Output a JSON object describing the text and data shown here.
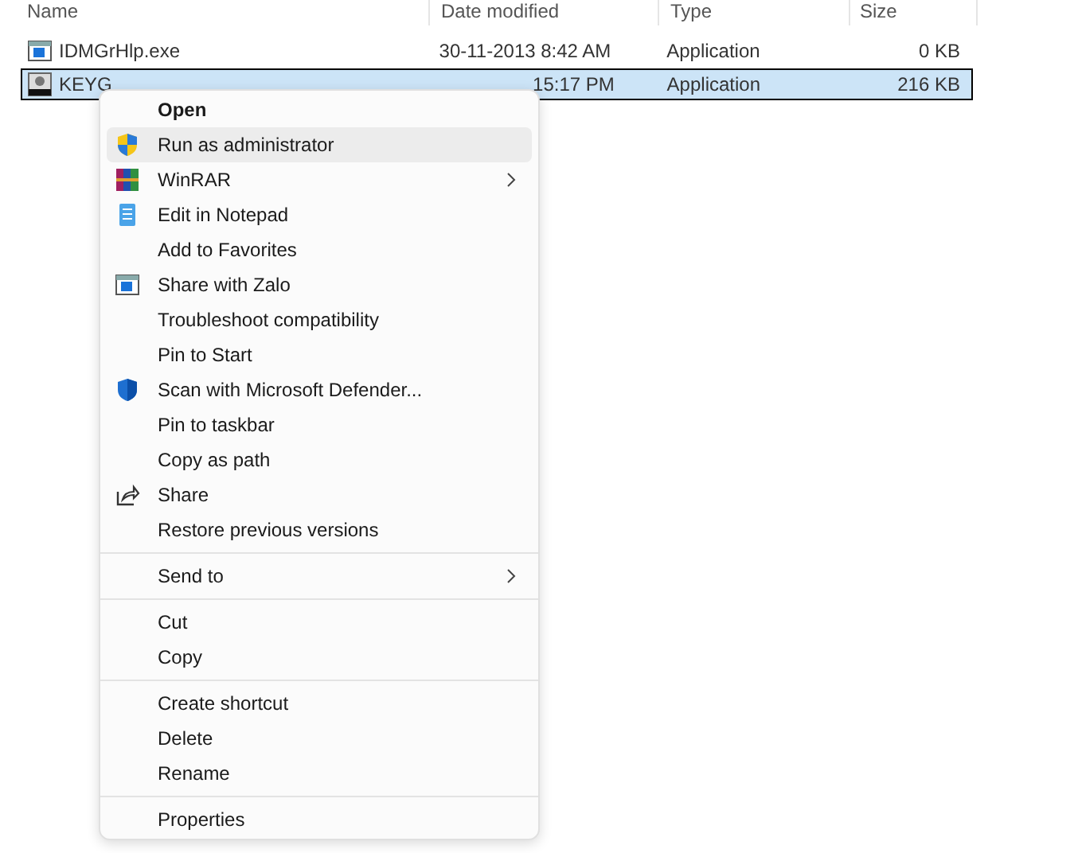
{
  "columns": [
    "Name",
    "Date modified",
    "Type",
    "Size"
  ],
  "files": [
    {
      "kind": "window",
      "name": "IDMGrHlp.exe",
      "date": "30-11-2013 8:42 AM",
      "type": "Application",
      "size": "0 KB",
      "selected": false
    },
    {
      "kind": "keygen",
      "name": "KEYG",
      "date": "15:17 PM",
      "type": "Application",
      "size": "216 KB",
      "selected": true
    }
  ],
  "menu": [
    {
      "kind": "item",
      "label": "Open",
      "default": true,
      "highlighted": false,
      "submenu": false
    },
    {
      "kind": "shield",
      "label": "Run as administrator",
      "default": false,
      "highlighted": true,
      "submenu": false
    },
    {
      "kind": "books",
      "label": "WinRAR",
      "default": false,
      "highlighted": false,
      "submenu": true
    },
    {
      "kind": "notepad",
      "label": "Edit in Notepad",
      "default": false,
      "highlighted": false,
      "submenu": false
    },
    {
      "kind": "item",
      "label": "Add to Favorites",
      "default": false,
      "highlighted": false,
      "submenu": false
    },
    {
      "kind": "window",
      "label": "Share with Zalo",
      "default": false,
      "highlighted": false,
      "submenu": false
    },
    {
      "kind": "item",
      "label": "Troubleshoot compatibility",
      "default": false,
      "highlighted": false,
      "submenu": false
    },
    {
      "kind": "item",
      "label": "Pin to Start",
      "default": false,
      "highlighted": false,
      "submenu": false
    },
    {
      "kind": "defender",
      "label": "Scan with Microsoft Defender...",
      "default": false,
      "highlighted": false,
      "submenu": false
    },
    {
      "kind": "item",
      "label": "Pin to taskbar",
      "default": false,
      "highlighted": false,
      "submenu": false
    },
    {
      "kind": "item",
      "label": "Copy as path",
      "default": false,
      "highlighted": false,
      "submenu": false
    },
    {
      "kind": "share",
      "label": "Share",
      "default": false,
      "highlighted": false,
      "submenu": false
    },
    {
      "kind": "item",
      "label": "Restore previous versions",
      "default": false,
      "highlighted": false,
      "submenu": false
    },
    {
      "kind": "separator"
    },
    {
      "kind": "item",
      "label": "Send to",
      "default": false,
      "highlighted": false,
      "submenu": true
    },
    {
      "kind": "separator"
    },
    {
      "kind": "item",
      "label": "Cut",
      "default": false,
      "highlighted": false,
      "submenu": false
    },
    {
      "kind": "item",
      "label": "Copy",
      "default": false,
      "highlighted": false,
      "submenu": false
    },
    {
      "kind": "separator"
    },
    {
      "kind": "item",
      "label": "Create shortcut",
      "default": false,
      "highlighted": false,
      "submenu": false
    },
    {
      "kind": "item",
      "label": "Delete",
      "default": false,
      "highlighted": false,
      "submenu": false
    },
    {
      "kind": "item",
      "label": "Rename",
      "default": false,
      "highlighted": false,
      "submenu": false
    },
    {
      "kind": "separator"
    },
    {
      "kind": "item",
      "label": "Properties",
      "default": false,
      "highlighted": false,
      "submenu": false
    }
  ]
}
